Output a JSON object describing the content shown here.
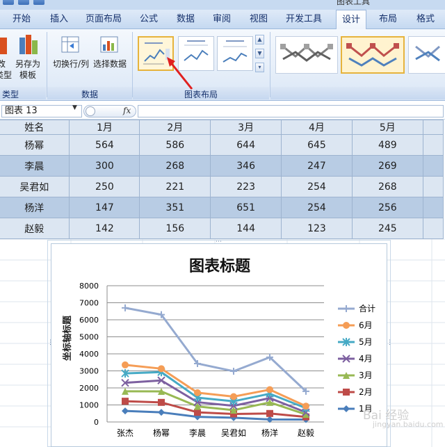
{
  "context_tab_title": "图表工具",
  "tabs": [
    {
      "label": "开始"
    },
    {
      "label": "插入"
    },
    {
      "label": "页面布局"
    },
    {
      "label": "公式"
    },
    {
      "label": "数据"
    },
    {
      "label": "审阅"
    },
    {
      "label": "视图"
    },
    {
      "label": "开发工具"
    },
    {
      "label": "设计"
    },
    {
      "label": "布局"
    },
    {
      "label": "格式"
    }
  ],
  "ribbon": {
    "type_group": {
      "btn1_label_top": "改",
      "btn1_label_bottom": "类型",
      "btn2_label_top": "另存为",
      "btn2_label_bottom": "模板",
      "label": "类型"
    },
    "data_group": {
      "switch_label": "切换行/列",
      "select_label": "选择数据",
      "label": "数据"
    },
    "layout_group": {
      "label": "图表布局"
    }
  },
  "formula_bar": {
    "name_box": "图表 13",
    "fx": "fx",
    "formula": ""
  },
  "table": {
    "headers": [
      "姓名",
      "1月",
      "2月",
      "3月",
      "4月",
      "5月"
    ],
    "rows": [
      [
        "杨幂",
        "564",
        "586",
        "644",
        "645",
        "489"
      ],
      [
        "李晨",
        "300",
        "268",
        "346",
        "247",
        "269"
      ],
      [
        "吴君如",
        "250",
        "221",
        "223",
        "254",
        "268"
      ],
      [
        "杨洋",
        "147",
        "351",
        "651",
        "254",
        "256"
      ],
      [
        "赵毅",
        "142",
        "156",
        "144",
        "123",
        "245"
      ]
    ]
  },
  "watermark": {
    "text": "Bai 经验",
    "url": "jingyan.baidu.com"
  },
  "colors": {
    "1月": "#4a7ebb",
    "2月": "#be4b48",
    "3月": "#98b954",
    "4月": "#7d60a0",
    "5月": "#46aac5",
    "6月": "#f59d56",
    "合计": "#95aad0"
  },
  "chart_data": {
    "type": "line",
    "title": "图表标题",
    "xlabel": "",
    "ylabel": "坐标轴标题",
    "categories": [
      "张杰",
      "杨幂",
      "李晨",
      "吴君如",
      "杨洋",
      "赵毅"
    ],
    "ylim": [
      0,
      8000
    ],
    "yticks": [
      0,
      1000,
      2000,
      3000,
      4000,
      5000,
      6000,
      7000,
      8000
    ],
    "grid": true,
    "legend_position": "right",
    "stacked": true,
    "series": [
      {
        "name": "1月",
        "marker": "diamond",
        "values": [
          650,
          564,
          300,
          250,
          147,
          142
        ]
      },
      {
        "name": "2月",
        "marker": "square",
        "values": [
          1220,
          1150,
          568,
          471,
          498,
          298
        ]
      },
      {
        "name": "3月",
        "marker": "triangle",
        "values": [
          1800,
          1794,
          914,
          694,
          1149,
          442
        ]
      },
      {
        "name": "4月",
        "marker": "x",
        "values": [
          2300,
          2439,
          1161,
          948,
          1403,
          565
        ]
      },
      {
        "name": "5月",
        "marker": "star",
        "values": [
          2850,
          2928,
          1430,
          1216,
          1659,
          810
        ]
      },
      {
        "name": "6月",
        "marker": "circle",
        "values": [
          3350,
          3130,
          1720,
          1490,
          1900,
          930
        ]
      },
      {
        "name": "合计",
        "marker": "plus",
        "values": [
          6700,
          6300,
          3430,
          2980,
          3800,
          1800
        ]
      }
    ]
  }
}
